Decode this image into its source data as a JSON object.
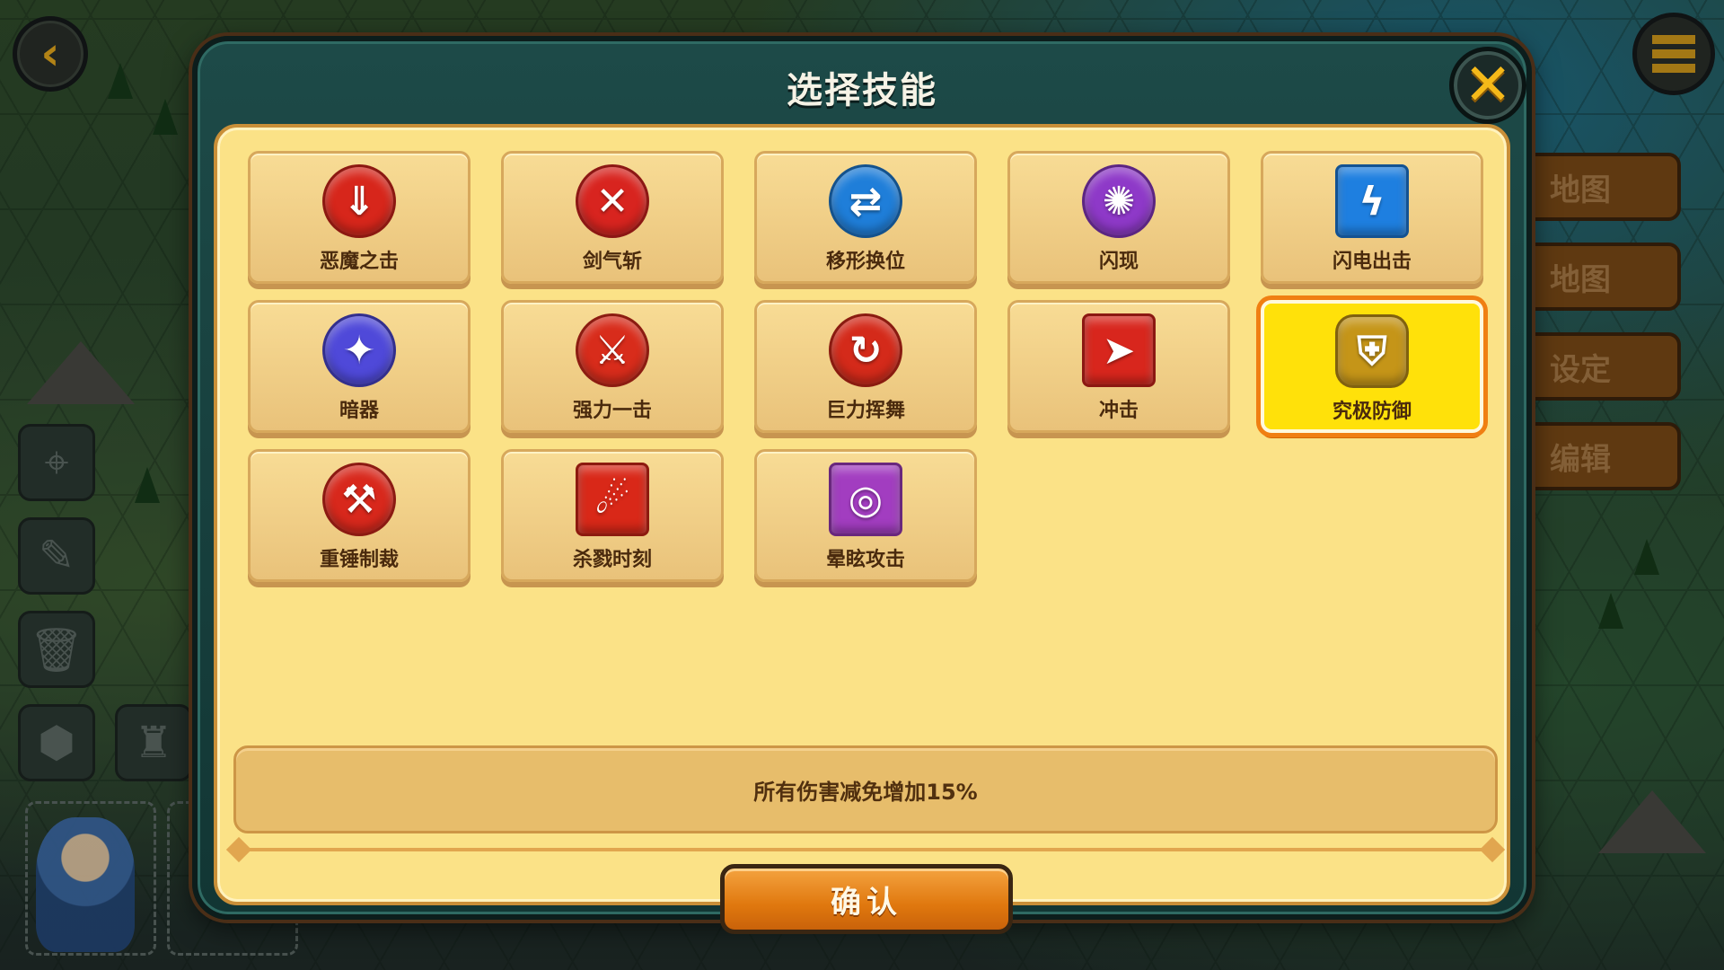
{
  "dialog": {
    "title": "选择技能",
    "confirm_label": "确认",
    "description": "所有伤害减免增加15%"
  },
  "colors": {
    "panel": "#fbe287",
    "selected": "#ffe10a",
    "selected_border": "#f07f12",
    "confirm": "#e0780e"
  },
  "skills": [
    {
      "name": "恶魔之击",
      "icon": "demon-strike-icon",
      "glyph": "⇓",
      "color": "#d7261b",
      "shape": "circle"
    },
    {
      "name": "剑气斩",
      "icon": "sword-qi-icon",
      "glyph": "✕",
      "color": "#d8241f",
      "shape": "circle"
    },
    {
      "name": "移形换位",
      "icon": "swap-position-icon",
      "glyph": "⇄",
      "color": "#1f7ed9",
      "shape": "circle"
    },
    {
      "name": "闪现",
      "icon": "blink-icon",
      "glyph": "✺",
      "color": "#8e39c8",
      "shape": "circle"
    },
    {
      "name": "闪电出击",
      "icon": "lightning-strike-icon",
      "glyph": "ϟ",
      "color": "#1e7fe0",
      "shape": "square"
    },
    {
      "name": "暗器",
      "icon": "hidden-weapon-icon",
      "glyph": "✦",
      "color": "#4f49d9",
      "shape": "circle"
    },
    {
      "name": "强力一击",
      "icon": "power-strike-icon",
      "glyph": "⚔",
      "color": "#d82c1b",
      "shape": "circle"
    },
    {
      "name": "巨力挥舞",
      "icon": "mighty-swing-icon",
      "glyph": "↻",
      "color": "#d42a1a",
      "shape": "circle"
    },
    {
      "name": "冲击",
      "icon": "charge-icon",
      "glyph": "➤",
      "color": "#d8261d",
      "shape": "square"
    },
    {
      "name": "究极防御",
      "icon": "ultimate-defense-icon",
      "glyph": "⛨",
      "color": "#c59518",
      "shape": "hex",
      "selected": true
    },
    {
      "name": "重锤制裁",
      "icon": "hammer-judgment-icon",
      "glyph": "⚒",
      "color": "#d8281c",
      "shape": "circle"
    },
    {
      "name": "杀戮时刻",
      "icon": "slaughter-moment-icon",
      "glyph": "☄",
      "color": "#d92818",
      "shape": "square"
    },
    {
      "name": "晕眩攻击",
      "icon": "stun-attack-icon",
      "glyph": "◎",
      "color": "#a23dc0",
      "shape": "square"
    }
  ],
  "background": {
    "back_icon": "back-arrow-icon",
    "menu_icon": "hamburger-menu-icon",
    "tool_icons": [
      "crosshair-icon",
      "brush-icon",
      "trash-icon",
      "hexagon-icon",
      "castle-icon"
    ],
    "right_menu": [
      "地图",
      "地图",
      "设定",
      "编辑"
    ]
  }
}
